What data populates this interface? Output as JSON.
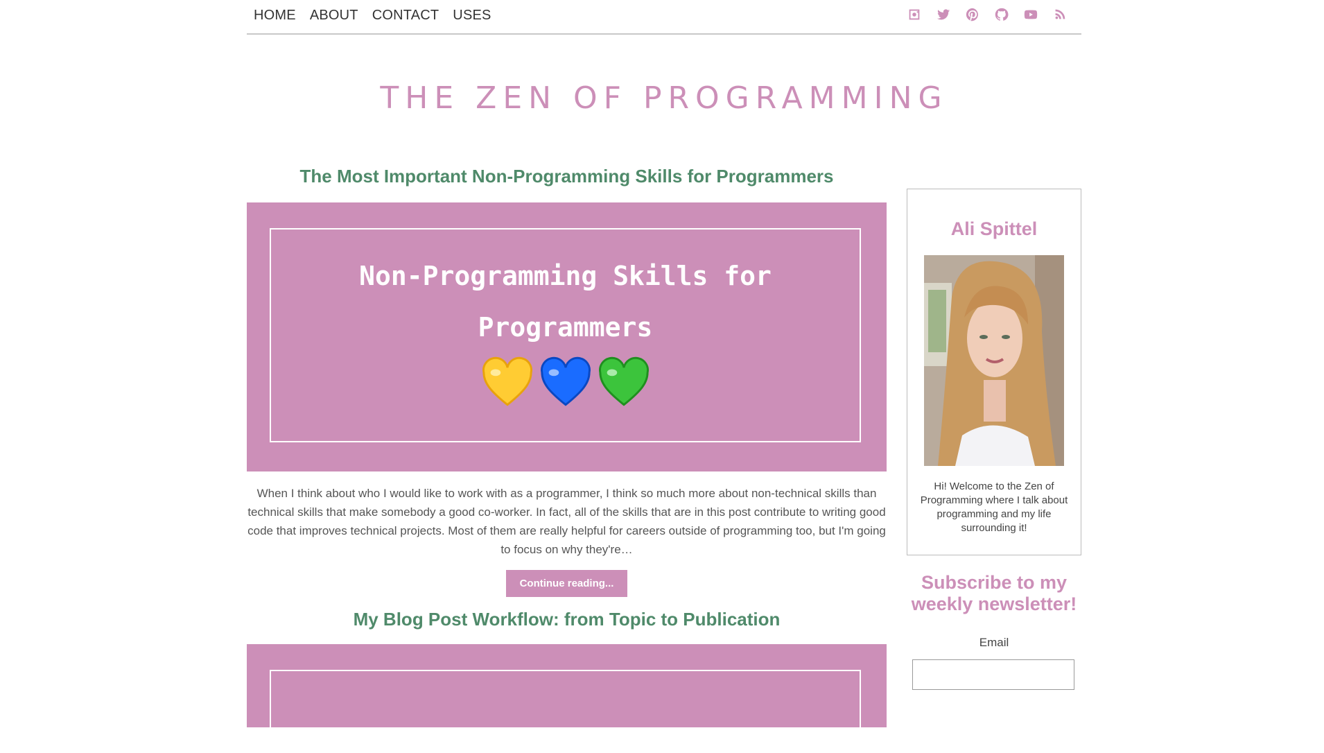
{
  "nav": {
    "links": [
      "HOME",
      "ABOUT",
      "CONTACT",
      "USES"
    ],
    "social_icons": [
      "instagram-icon",
      "twitter-icon",
      "pinterest-icon",
      "github-icon",
      "youtube-icon",
      "rss-icon"
    ]
  },
  "site": {
    "title": "THE ZEN OF PROGRAMMING"
  },
  "posts": [
    {
      "title": "The Most Important Non-Programming Skills for Programmers",
      "hero_line1": "Non-Programming Skills for",
      "hero_line2": "Programmers",
      "hero_emoji": [
        "yellow-heart",
        "blue-heart",
        "green-heart"
      ],
      "excerpt": "When I think about who I would like to work with as a programmer, I think so much more about non-technical skills than technical skills that make somebody a good co-worker. In fact, all of the skills that are in this post contribute to writing good code that improves technical projects. Most of them are really helpful for careers outside of programming too, but I'm going to focus on why they're…",
      "button": "Continue reading..."
    },
    {
      "title": "My Blog Post Workflow: from Topic to Publication"
    }
  ],
  "sidebar": {
    "name": "Ali Spittel",
    "bio": "Hi! Welcome to the Zen of Programming where I talk about programming and my life surrounding it!",
    "subscribe_heading": "Subscribe to my weekly newsletter!",
    "email_label": "Email",
    "email_value": ""
  },
  "colors": {
    "accent": "#cc8fb8",
    "post_title": "#4f8a6a",
    "text": "#444444",
    "nav_border": "#c8c8c8"
  }
}
